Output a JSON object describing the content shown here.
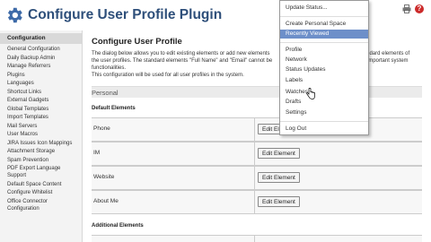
{
  "header": {
    "title": "Configure User Profile Plugin",
    "logo_icon": "gear-icon",
    "print_icon": "print-icon",
    "help_icon": "help-icon",
    "help_glyph": "?"
  },
  "sidebar": {
    "heading": "Configuration",
    "items": [
      "General Configuration",
      "Daily Backup Admin",
      "Manage Referrers",
      "Plugins",
      "Languages",
      "Shortcut Links",
      "External Gadgets",
      "Global Templates",
      "Import Templates",
      "Mail Servers",
      "User Macros",
      "JIRA Issues Icon Mappings",
      "Attachment Storage",
      "Spam Prevention",
      "PDF Export Language Support",
      "Default Space Content",
      "Configure Whitelist",
      "Office Connector Configuration"
    ]
  },
  "main": {
    "title": "Configure User Profile",
    "description_1": "The dialog below allows you to edit existing elements or add new elements",
    "description_1b": "standard elements of",
    "description_2": "the user profiles. The standard elements \"Full Name\" and \"Email\" cannot be",
    "description_2b": "important system",
    "description_3": "functionalities.",
    "description_4": "This configuration will be used for all user profiles in the system.",
    "section_personal": "Personal",
    "default_elements": "Default Elements",
    "additional_elements": "Additional Elements",
    "fields": [
      {
        "label": "Phone",
        "button": "Edit Element"
      },
      {
        "label": "IM",
        "button": "Edit Element"
      },
      {
        "label": "Website",
        "button": "Edit Element"
      },
      {
        "label": "About Me",
        "button": "Edit Element"
      }
    ]
  },
  "user_menu": {
    "items": [
      "Update Status...",
      "Create Personal Space",
      "Recently Viewed",
      "Profile",
      "Network",
      "Status Updates",
      "Labels",
      "Watches",
      "Drafts",
      "Settings",
      "Log Out"
    ],
    "highlighted": "Recently Viewed"
  },
  "colors": {
    "title_blue": "#2e4f7a",
    "menu_highlight": "#6d8fc9",
    "help_red": "#cc2b2b"
  }
}
